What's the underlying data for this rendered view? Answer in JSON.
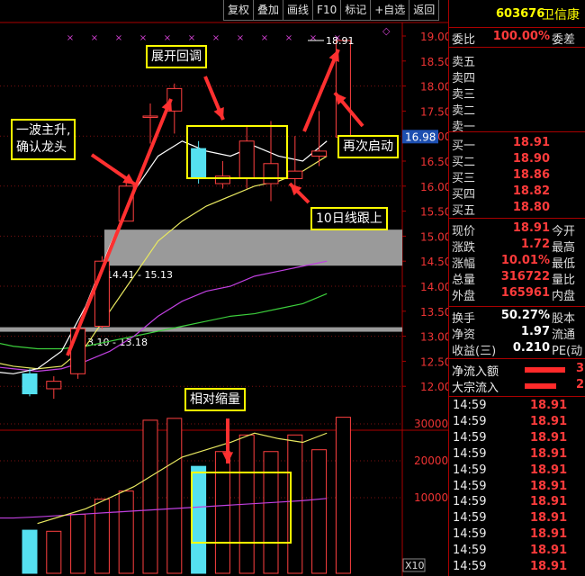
{
  "toolbar": [
    "复权",
    "叠加",
    "画线",
    "F10",
    "标记",
    "+自选",
    "返回"
  ],
  "stock": {
    "code": "603676",
    "name": "卫信康"
  },
  "order_book": {
    "ratio_label": "委比",
    "ratio_value": "100.00%",
    "diff_label": "委差",
    "sell": [
      {
        "label": "卖五",
        "price": "",
        "vol": ""
      },
      {
        "label": "卖四",
        "price": "",
        "vol": ""
      },
      {
        "label": "卖三",
        "price": "",
        "vol": ""
      },
      {
        "label": "卖二",
        "price": "",
        "vol": ""
      },
      {
        "label": "卖一",
        "price": "",
        "vol": ""
      }
    ],
    "buy": [
      {
        "label": "买一",
        "price": "18.91"
      },
      {
        "label": "买二",
        "price": "18.90"
      },
      {
        "label": "买三",
        "price": "18.86"
      },
      {
        "label": "买四",
        "price": "18.82"
      },
      {
        "label": "买五",
        "price": "18.80"
      }
    ]
  },
  "quote": [
    {
      "label": "现价",
      "value": "18.91",
      "label2": "今开"
    },
    {
      "label": "涨跌",
      "value": "1.72",
      "label2": "最高"
    },
    {
      "label": "涨幅",
      "value": "10.01%",
      "label2": "最低"
    },
    {
      "label": "总量",
      "value": "316722",
      "label2": "量比"
    },
    {
      "label": "外盘",
      "value": "165961",
      "label2": "内盘"
    }
  ],
  "stats": [
    {
      "label": "换手",
      "value": "50.27%",
      "label2": "股本"
    },
    {
      "label": "净资",
      "value": "1.97",
      "label2": "流通"
    },
    {
      "label": "收益(三)",
      "value": "0.210",
      "label2": "PE(动"
    }
  ],
  "flows": [
    {
      "label": "净流入额",
      "value": "3",
      "fill": 0.45
    },
    {
      "label": "大宗流入",
      "value": "2",
      "fill": 0.35
    }
  ],
  "ticks": [
    {
      "time": "14:59",
      "price": "18.91"
    },
    {
      "time": "14:59",
      "price": "18.91"
    },
    {
      "time": "14:59",
      "price": "18.91"
    },
    {
      "time": "14:59",
      "price": "18.91"
    },
    {
      "time": "14:59",
      "price": "18.91"
    },
    {
      "time": "14:59",
      "price": "18.91"
    },
    {
      "time": "14:59",
      "price": "18.91"
    },
    {
      "time": "14:59",
      "price": "18.91"
    },
    {
      "time": "14:59",
      "price": "18.91"
    },
    {
      "time": "14:59",
      "price": "18.91"
    },
    {
      "time": "14:59",
      "price": "18.91"
    }
  ],
  "chart": {
    "price_axis": [
      "19.00",
      "18.50",
      "18.00",
      "17.50",
      "17.00",
      "16.50",
      "16.00",
      "15.50",
      "15.00",
      "14.50",
      "14.00",
      "13.50",
      "13.00",
      "12.50",
      "12.00"
    ],
    "current_price_tag": "16.98",
    "high_label": "18.91",
    "zone_upper_label": "14.41 - 15.13",
    "zone_lower_label": "13.10 - 13.18",
    "volume_axis": [
      "30000",
      "20000",
      "10000"
    ],
    "volume_unit": "X10",
    "zones": [
      {
        "low": 14.41,
        "high": 15.13
      },
      {
        "low": 13.1,
        "high": 13.18
      }
    ],
    "candles": [
      {
        "o": 12.25,
        "c": 11.85,
        "h": 12.35,
        "l": 11.8,
        "color": "cyan",
        "vol": 1200
      },
      {
        "o": 11.95,
        "c": 12.1,
        "h": 12.2,
        "l": 11.75,
        "color": "red",
        "vol": 900
      },
      {
        "o": 12.25,
        "c": 13.15,
        "h": 13.2,
        "l": 12.15,
        "color": "red",
        "vol": 5500
      },
      {
        "o": 13.2,
        "c": 14.5,
        "h": 14.6,
        "l": 13.15,
        "color": "red",
        "vol": 9600
      },
      {
        "o": 15.3,
        "c": 16.0,
        "h": 16.15,
        "l": 15.3,
        "color": "red",
        "vol": 11800
      },
      {
        "o": 17.4,
        "c": 17.4,
        "h": 17.65,
        "l": 16.85,
        "color": "red",
        "vol": 31000
      },
      {
        "o": 17.5,
        "c": 17.95,
        "h": 18.05,
        "l": 17.05,
        "color": "red",
        "vol": 31500
      },
      {
        "o": 16.75,
        "c": 16.15,
        "h": 16.9,
        "l": 16.05,
        "color": "cyan",
        "vol": 18500
      },
      {
        "o": 16.2,
        "c": 16.05,
        "h": 16.5,
        "l": 15.95,
        "color": "red",
        "vol": 22500
      },
      {
        "o": 16.15,
        "c": 16.9,
        "h": 17.2,
        "l": 15.95,
        "color": "red",
        "vol": 27000
      },
      {
        "o": 16.05,
        "c": 16.45,
        "h": 17.3,
        "l": 15.7,
        "color": "red",
        "vol": 22500
      },
      {
        "o": 16.15,
        "c": 16.3,
        "h": 17.0,
        "l": 15.9,
        "color": "red",
        "vol": 27000
      },
      {
        "o": 16.7,
        "c": 16.6,
        "h": 17.5,
        "l": 16.4,
        "color": "red",
        "vol": 23000
      },
      {
        "o": 16.98,
        "c": 18.91,
        "h": 18.91,
        "l": 16.9,
        "color": "red",
        "vol": 31800
      }
    ],
    "ma5": [
      12.3,
      12.25,
      12.35,
      12.7,
      13.6,
      14.8,
      15.9,
      16.6,
      16.9,
      16.7,
      16.6,
      16.8,
      16.6,
      16.5,
      16.9
    ],
    "ma10": [
      12.5,
      12.4,
      12.35,
      12.4,
      12.8,
      13.5,
      14.2,
      14.9,
      15.3,
      15.6,
      15.8,
      16.0,
      16.1,
      16.3,
      16.6
    ],
    "ma20": [
      12.4,
      12.35,
      12.3,
      12.35,
      12.5,
      12.7,
      13.0,
      13.4,
      13.7,
      13.9,
      14.0,
      14.2,
      14.3,
      14.4,
      14.5
    ],
    "ma60": [
      12.9,
      12.8,
      12.75,
      12.75,
      12.8,
      12.9,
      13.0,
      13.1,
      13.2,
      13.3,
      13.4,
      13.45,
      13.55,
      13.65,
      13.85
    ],
    "vol_ma_yellow": [
      null,
      null,
      3000,
      5000,
      7000,
      10000,
      13000,
      17000,
      21000,
      23000,
      25000,
      27500,
      26000,
      25000,
      27500
    ],
    "vol_ma_magenta": [
      4500,
      4500,
      4800,
      5200,
      5600,
      6000,
      6400,
      6800,
      7200,
      7600,
      8000,
      8400,
      8800,
      9200,
      9800
    ]
  },
  "callouts": {
    "wave": "一波主升,\n确认龙头",
    "expand": "展开回调",
    "restart": "再次启动",
    "ma10": "10日线跟上",
    "volume": "相对缩量"
  }
}
